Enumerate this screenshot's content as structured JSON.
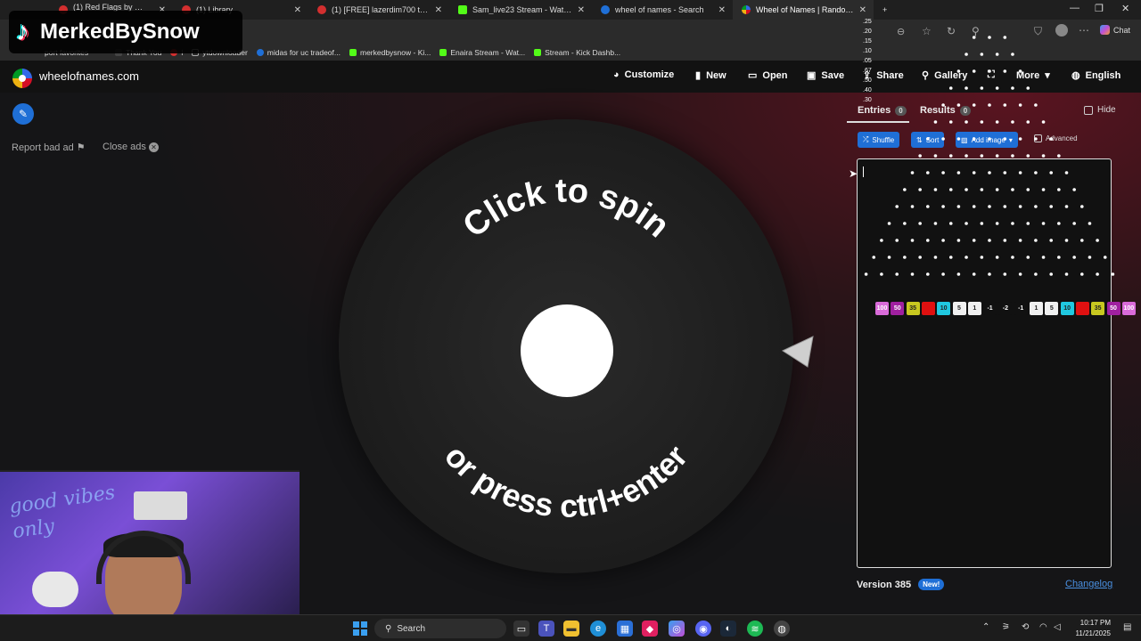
{
  "browser": {
    "tabs": [
      {
        "title": "(1) Red Flags by ꧁ᴛʀᴇʟʟᴢ꧂ | Be",
        "favicon_color": "#d32f2f"
      },
      {
        "title": "(1) Library",
        "favicon_color": "#d32f2f"
      },
      {
        "title": "(1) [FREE] lazerdim700 type beat",
        "favicon_color": "#d32f2f"
      },
      {
        "title": "Sam_live23 Stream - Watch Live o",
        "favicon_color": "#53fc18"
      },
      {
        "title": "wheel of names - Search",
        "favicon_color": "#1f6fd6"
      },
      {
        "title": "Wheel of Names | Random name",
        "favicon_color": "#3369e8"
      }
    ],
    "new_tab": "+",
    "chat_label": "Chat",
    "bookmarks": [
      {
        "label": "port favorites",
        "color": "#888"
      },
      {
        "label": "Thank You",
        "color": "#444"
      },
      {
        "label": "i",
        "color": "#d32f2f"
      },
      {
        "label": "ytdownloader",
        "color": "#888"
      },
      {
        "label": "midas for uc tradeof...",
        "color": "#1f6fd6"
      },
      {
        "label": "merkedbysnow - Ki...",
        "color": "#53fc18"
      },
      {
        "label": "Enaira Stream - Wat...",
        "color": "#53fc18"
      },
      {
        "label": "Stream - Kick Dashb...",
        "color": "#53fc18"
      }
    ]
  },
  "watermark": {
    "text": "MerkedBySnow"
  },
  "site": {
    "name": "wheelofnames.com",
    "nav": {
      "customize": "Customize",
      "new": "New",
      "open": "Open",
      "save": "Save",
      "share": "Share",
      "gallery": "Gallery",
      "more": "More",
      "language": "English"
    }
  },
  "left": {
    "report_ad": "Report bad ad",
    "close_ads": "Close ads"
  },
  "wheel": {
    "top_text": "Click to spin",
    "bottom_text": "or press ctrl+enter"
  },
  "panel": {
    "tabs": [
      {
        "label": "Entries",
        "count": "0"
      },
      {
        "label": "Results",
        "count": "0"
      }
    ],
    "hide_label": "Hide",
    "buttons": {
      "shuffle": "Shuffle",
      "sort": "Sort",
      "add_image": "Add image"
    },
    "advanced_label": "Advanced",
    "version": "Version 385",
    "new_badge": "New!",
    "changelog": "Changelog"
  },
  "plinko": {
    "ticks": [
      ".25",
      ".20",
      ".15",
      ".10",
      ".05",
      ".67",
      ".50",
      ".40",
      ".30"
    ],
    "slots": [
      {
        "label": "100",
        "color": "#d96bd9"
      },
      {
        "label": "50",
        "color": "#a020a0"
      },
      {
        "label": "35",
        "color": "#c8c820"
      },
      {
        "label": "",
        "color": "#e01010"
      },
      {
        "label": "10",
        "color": "#20c8e0"
      },
      {
        "label": "5",
        "color": "#f0f0f0"
      },
      {
        "label": "1",
        "color": "#f0f0f0"
      },
      {
        "label": "-1",
        "color": "#111111"
      },
      {
        "label": "-2",
        "color": "#111111"
      },
      {
        "label": "-1",
        "color": "#111111"
      },
      {
        "label": "1",
        "color": "#f0f0f0"
      },
      {
        "label": "5",
        "color": "#f0f0f0"
      },
      {
        "label": "10",
        "color": "#20c8e0"
      },
      {
        "label": "",
        "color": "#e01010"
      },
      {
        "label": "35",
        "color": "#c8c820"
      },
      {
        "label": "50",
        "color": "#a020a0"
      },
      {
        "label": "100",
        "color": "#d96bd9"
      }
    ]
  },
  "webcam": {
    "poster_text": "good vibes only"
  },
  "taskbar": {
    "search": "Search",
    "time": "10:17 PM",
    "date": "11/21/2025"
  }
}
